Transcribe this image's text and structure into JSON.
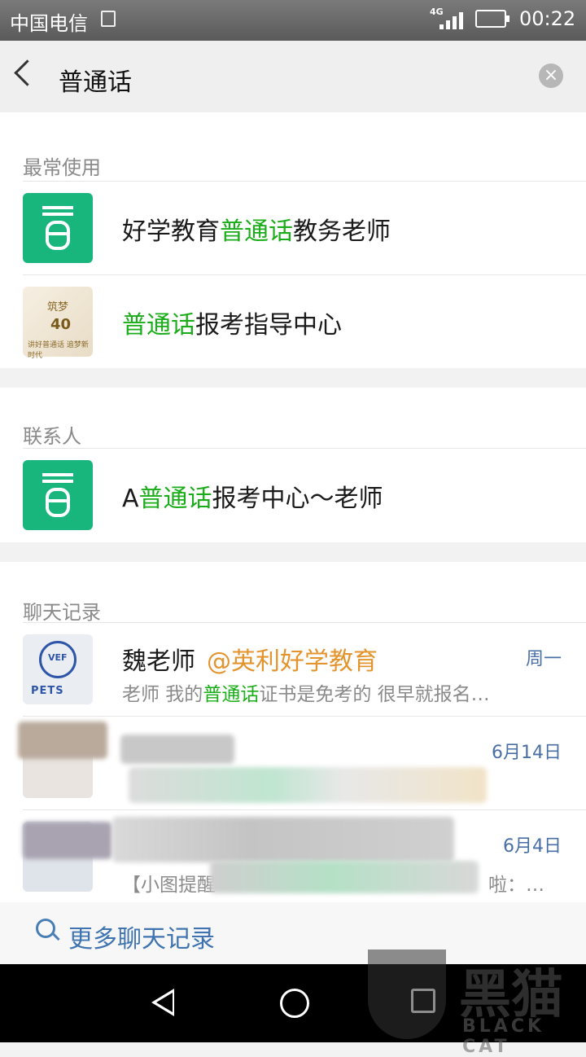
{
  "status_bar": {
    "carrier": "中国电信",
    "network": "4G",
    "time": "00:22"
  },
  "search": {
    "query": "普通话"
  },
  "sections": {
    "frequent": {
      "title": "最常使用",
      "items": [
        {
          "pre": "好学教育",
          "hl": "普通话",
          "post": "教务老师",
          "avatar": "pu-app-icon"
        },
        {
          "pre": "",
          "hl": "普通话",
          "post": "报考指导中心",
          "avatar": "poster-image",
          "poster_lines": [
            "筑梦",
            "40",
            "讲好普通话 追梦新时代"
          ]
        }
      ]
    },
    "contacts": {
      "title": "联系人",
      "items": [
        {
          "pre": "A",
          "hl": "普通话",
          "post": "报考中心～老师",
          "avatar": "pu-app-icon"
        }
      ]
    },
    "chats": {
      "title": "聊天记录",
      "items": [
        {
          "name": "魏老师",
          "tag": "@英利好学教育",
          "date": "周一",
          "snippet_pre": "老师 我的",
          "snippet_hl": "普通话",
          "snippet_post": "证书是免考的 很早就报名…",
          "avatar_label": "PETS"
        },
        {
          "date": "6月14日"
        },
        {
          "date": "6月4日",
          "snippet_fragment": "【小图提醒",
          "snippet_tail": "啦：…"
        }
      ]
    }
  },
  "more_link": {
    "label": "更多聊天记录"
  },
  "watermark": {
    "cn": "黑猫",
    "en": "BLACK CAT"
  }
}
